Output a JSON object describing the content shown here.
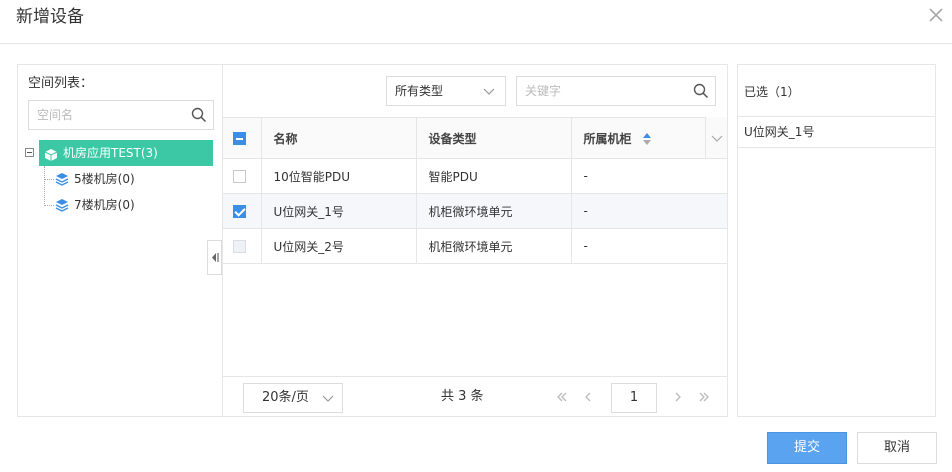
{
  "dialog": {
    "title": "新增设备"
  },
  "left": {
    "title": "空间列表：",
    "search_placeholder": "空间名",
    "tree": {
      "root": "机房应用TEST(3)",
      "children": [
        "5楼机房(0)",
        "7楼机房(0)"
      ]
    }
  },
  "center": {
    "type_filter": "所有类型",
    "keyword_placeholder": "关键字",
    "columns": [
      "名称",
      "设备类型",
      "所属机柜"
    ],
    "rows": [
      {
        "name": "10位智能PDU",
        "type": "智能PDU",
        "cabinet": "-",
        "checked": false
      },
      {
        "name": "U位网关_1号",
        "type": "机柜微环境单元",
        "cabinet": "-",
        "checked": true
      },
      {
        "name": "U位网关_2号",
        "type": "机柜微环境单元",
        "cabinet": "-",
        "checked": false
      }
    ],
    "pager": {
      "page_size": "20条/页",
      "total": "共 3 条",
      "current_page": "1"
    }
  },
  "right": {
    "title": "已选（1）",
    "items": [
      "U位网关_1号"
    ]
  },
  "footer": {
    "submit": "提交",
    "cancel": "取消"
  },
  "colors": {
    "accent": "#3a8ee6",
    "tree_selected": "#3cc8a5",
    "submit_bg": "#5aa3f0"
  }
}
